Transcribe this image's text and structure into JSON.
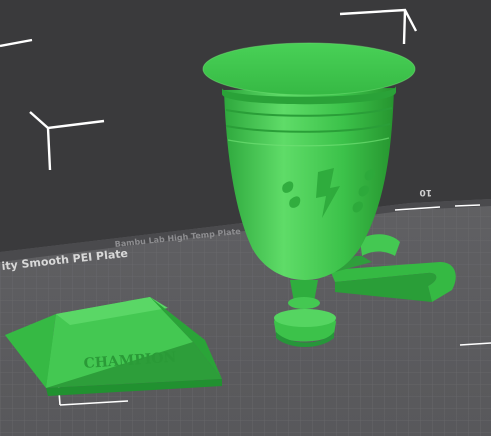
{
  "viewport": {
    "bed_label": "ity Smooth PEI Plate",
    "bed_label_faint": "Bambu Lab High Temp Plate",
    "bed_number": "10",
    "champion_text": "CHAMPION",
    "colors": {
      "background": "#3a3a3c",
      "bed": "#5c5c5f",
      "model_green": "#3cc24a",
      "model_highlight": "#6fe073",
      "model_shadow": "#229a31",
      "grid": "#7a7a7d"
    }
  }
}
